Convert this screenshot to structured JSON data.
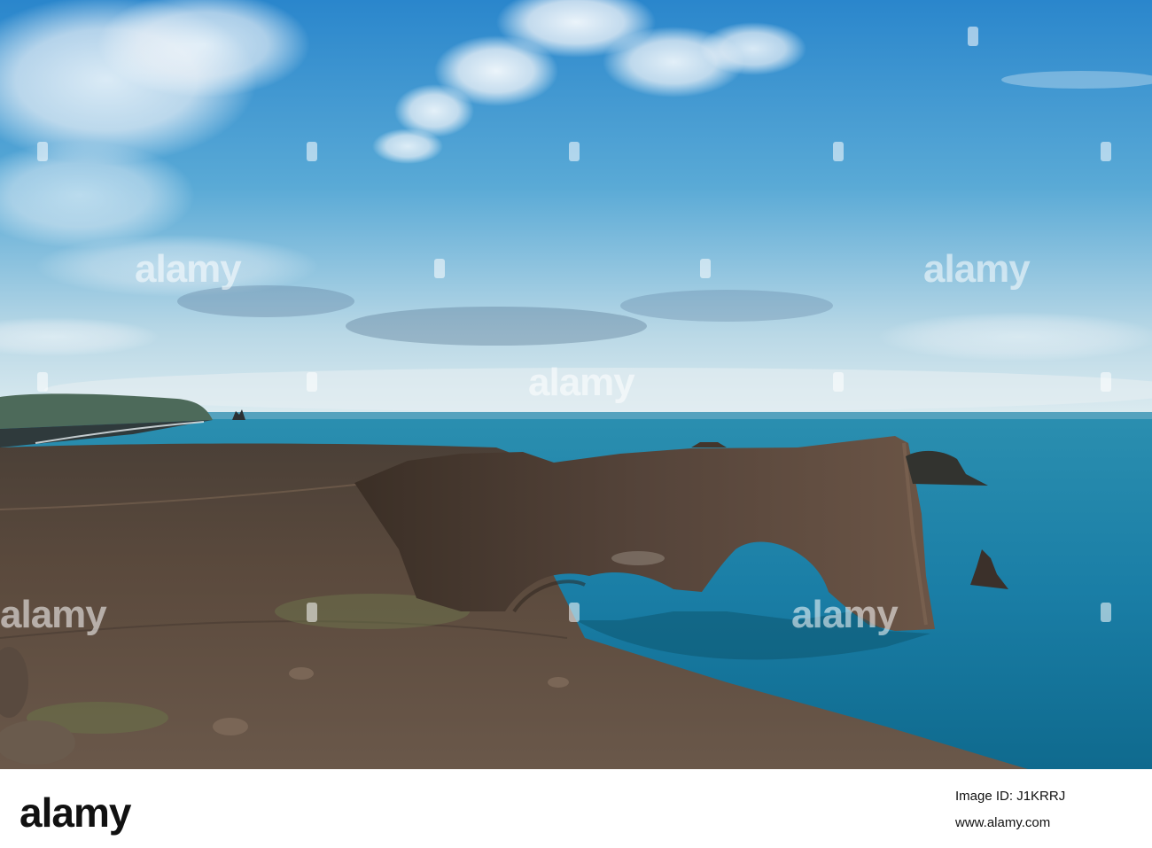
{
  "watermark": {
    "brand": "alamy"
  },
  "footer": {
    "logo": "alamy",
    "image_id_line": "Image ID: J1KRRJ",
    "url": "www.alamy.com"
  },
  "colors": {
    "sky_top": "#2f8fd0",
    "sky_horizon": "#d8e8ee",
    "ocean": "#1e7fa3",
    "ocean_deep": "#0f5e7c",
    "rock_arch": "#4a3a2e",
    "foreground": "#5a4a3e",
    "footer_bg": "#ffffff",
    "footer_text": "#111111"
  }
}
